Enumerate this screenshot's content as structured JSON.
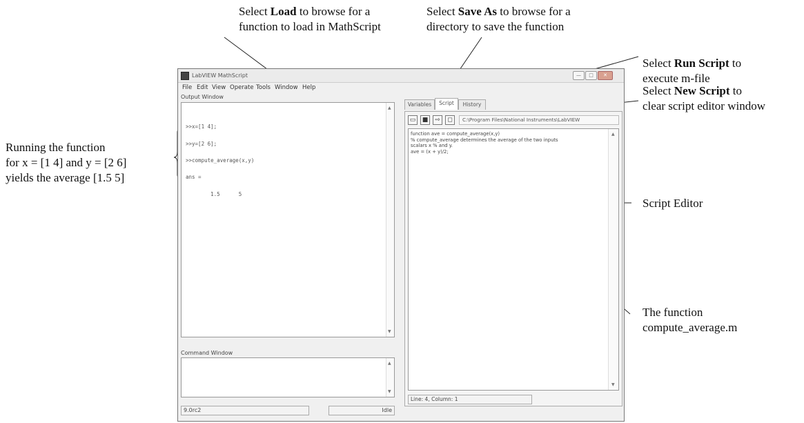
{
  "annotations": {
    "load": {
      "prefix": "Select ",
      "bold": "Load",
      "suffix": " to browse for a",
      "line2": "function to load in MathScript"
    },
    "save_as": {
      "prefix": "Select ",
      "bold": "Save As",
      "suffix": " to browse for a",
      "line2": "directory to save the function"
    },
    "run_script": {
      "prefix": "Select ",
      "bold": "Run Script",
      "suffix": " to",
      "line2": "execute m-file"
    },
    "new_script": {
      "prefix": "Select ",
      "bold": "New Script",
      "suffix": " to",
      "line2": "clear script editor window"
    },
    "running": {
      "line1": "Running the function",
      "line2": "for x = [1 4] and y = [2 6]",
      "line3": "yields the average [1.5 5]"
    },
    "script_editor": "Script Editor",
    "function_file": {
      "line1": "The function",
      "line2": "compute_average.m"
    }
  },
  "window": {
    "title": "LabVIEW MathScript",
    "menu": [
      "File",
      "Edit",
      "View",
      "Operate",
      "Tools",
      "Window",
      "Help"
    ],
    "output_label": "Output Window",
    "output_lines": [
      ">>x=[1 4];",
      ">>y=[2 6];",
      ">>compute_average(x,y)",
      "ans =",
      "        1.5      5"
    ],
    "command_label": "Command Window",
    "version": "9.0rc2",
    "state": "Idle",
    "tabs": [
      "Variables",
      "Script",
      "History"
    ],
    "path": "C:\\Program Files\\National Instruments\\LabVIEW",
    "script_lines": [
      "function ave = compute_average(x,y)",
      "% compute_average determines the average of the two inputs",
      "scalars x % and y.",
      "ave = (x + y)/2;"
    ],
    "cursor_status": "Line: 4, Column: 1"
  }
}
